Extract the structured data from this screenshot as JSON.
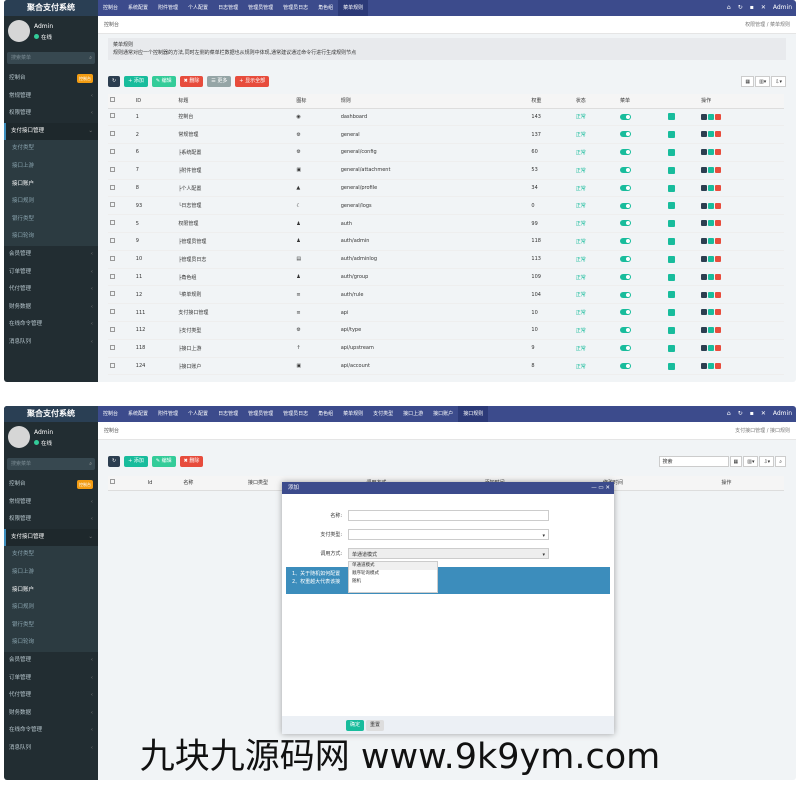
{
  "app": {
    "brand": "聚合支付系统",
    "user": "Admin",
    "status": "在线",
    "search_placeholder": "搜索菜单",
    "admin_name": "Admin"
  },
  "panel1": {
    "menu": [
      {
        "label": "控制台",
        "type": "top",
        "badge": "new"
      },
      {
        "label": "常规管理",
        "type": "top"
      },
      {
        "label": "权限管理",
        "type": "top"
      },
      {
        "label": "支付接口管理",
        "type": "open"
      },
      {
        "label": "支付类型",
        "type": "sub"
      },
      {
        "label": "接口上游",
        "type": "sub"
      },
      {
        "label": "接口账户",
        "type": "sub",
        "active": true
      },
      {
        "label": "接口规则",
        "type": "sub"
      },
      {
        "label": "银行类型",
        "type": "sub"
      },
      {
        "label": "接口轮询",
        "type": "sub"
      },
      {
        "label": "会员管理",
        "type": "top"
      },
      {
        "label": "订单管理",
        "type": "top"
      },
      {
        "label": "代付管理",
        "type": "top"
      },
      {
        "label": "财务数据",
        "type": "top"
      },
      {
        "label": "在线命令管理",
        "type": "top"
      },
      {
        "label": "消息队列",
        "type": "top"
      }
    ],
    "tabs": [
      "控制台",
      "系统配置",
      "附件管理",
      "个人配置",
      "日志管理",
      "管理员管理",
      "管理员日志",
      "角色组",
      "菜单规则"
    ],
    "breadcrumb": "控制台",
    "breadcrumb_right": "权限管理 / 菜单规则",
    "notice_title": "菜单规则",
    "notice_text": "规则通常对应一个控制器的方法,同时左侧的菜单栏数据也从规则中体现,通常建议通过命令行进行生成规则节点",
    "buttons": [
      "添加",
      "编辑",
      "删除",
      "更多",
      "显示全部"
    ],
    "columns": [
      "ID",
      "标题",
      "图标",
      "规则",
      "权重",
      "状态",
      "菜单",
      "",
      "操作"
    ],
    "rows": [
      {
        "id": "1",
        "title": "控制台",
        "rule": "dashboard",
        "weight": "143",
        "status": "正常"
      },
      {
        "id": "2",
        "title": "常规管理",
        "rule": "general",
        "weight": "137",
        "status": "正常"
      },
      {
        "id": "6",
        "title": "├系统配置",
        "rule": "general/config",
        "weight": "60",
        "status": "正常"
      },
      {
        "id": "7",
        "title": "├附件管理",
        "rule": "general/attachment",
        "weight": "53",
        "status": "正常"
      },
      {
        "id": "8",
        "title": "├个人配置",
        "rule": "general/profile",
        "weight": "34",
        "status": "正常"
      },
      {
        "id": "93",
        "title": "└日志管理",
        "rule": "general/logs",
        "weight": "0",
        "status": "正常"
      },
      {
        "id": "5",
        "title": "权限管理",
        "rule": "auth",
        "weight": "99",
        "status": "正常"
      },
      {
        "id": "9",
        "title": "├管理员管理",
        "rule": "auth/admin",
        "weight": "118",
        "status": "正常"
      },
      {
        "id": "10",
        "title": "├管理员日志",
        "rule": "auth/adminlog",
        "weight": "113",
        "status": "正常"
      },
      {
        "id": "11",
        "title": "├角色组",
        "rule": "auth/group",
        "weight": "109",
        "status": "正常"
      },
      {
        "id": "12",
        "title": "└菜单规则",
        "rule": "auth/rule",
        "weight": "104",
        "status": "正常"
      },
      {
        "id": "111",
        "title": "支付接口管理",
        "rule": "api",
        "weight": "10",
        "status": "正常"
      },
      {
        "id": "112",
        "title": "├支付类型",
        "rule": "api/type",
        "weight": "10",
        "status": "正常"
      },
      {
        "id": "118",
        "title": "├接口上游",
        "rule": "api/upstream",
        "weight": "9",
        "status": "正常"
      },
      {
        "id": "124",
        "title": "├接口账户",
        "rule": "api/account",
        "weight": "8",
        "status": "正常"
      }
    ]
  },
  "panel2": {
    "tabs": [
      "控制台",
      "系统配置",
      "附件管理",
      "个人配置",
      "日志管理",
      "管理员管理",
      "管理员日志",
      "角色组",
      "菜单规则",
      "支付类型",
      "接口上游",
      "接口账户",
      "接口规则"
    ],
    "breadcrumb": "控制台",
    "breadcrumb_right": "支付接口管理 / 接口规则",
    "search_placeholder": "搜索",
    "buttons": [
      "添加",
      "编辑",
      "删除"
    ],
    "columns": [
      "Id",
      "名称",
      "接口类型",
      "调用方式",
      "添加时间",
      "修改时间",
      "操作"
    ],
    "modal": {
      "title": "添加",
      "name_label": "名称:",
      "type_label": "支付类型:",
      "method_label": "调用方式:",
      "method_value": "单通道模式",
      "options": [
        "单通道模式",
        "顺序轮询模式",
        "随机"
      ],
      "tip1": "1、关于随机如何配置",
      "tip2": "2、权重越大代表该接",
      "ok": "确定",
      "reset": "重置"
    }
  },
  "watermark": "九块九源码网 www.9k9ym.com"
}
